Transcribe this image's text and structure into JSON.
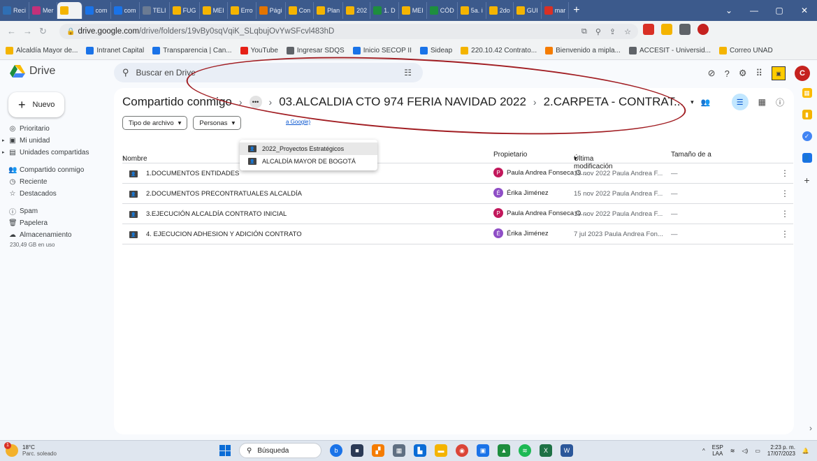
{
  "browser": {
    "tabs": [
      {
        "label": "Reci",
        "color": "#2f6fb4"
      },
      {
        "label": "Mer",
        "color": "#c3317a"
      },
      {
        "label": "",
        "color": "#f4b400",
        "active": true
      },
      {
        "label": "com",
        "color": "#1a73e8"
      },
      {
        "label": "com",
        "color": "#1a73e8"
      },
      {
        "label": "TELI",
        "color": "#6b7b93"
      },
      {
        "label": "FUG",
        "color": "#f4b400"
      },
      {
        "label": "MEI",
        "color": "#f4b400"
      },
      {
        "label": "Erro",
        "color": "#f4b400"
      },
      {
        "label": "Pági",
        "color": "#e37400"
      },
      {
        "label": "Con",
        "color": "#f4b400"
      },
      {
        "label": "Plan",
        "color": "#f4b400"
      },
      {
        "label": "202",
        "color": "#f4b400"
      },
      {
        "label": "1. D",
        "color": "#1e8e3e"
      },
      {
        "label": "MEI",
        "color": "#f4b400"
      },
      {
        "label": "CÓD",
        "color": "#1e8e3e"
      },
      {
        "label": "5a. i",
        "color": "#f4b400"
      },
      {
        "label": "2do",
        "color": "#f4b400"
      },
      {
        "label": "GUI",
        "color": "#f4b400"
      },
      {
        "label": "mar",
        "color": "#d93025"
      }
    ],
    "new_tab": "+",
    "url_host": "drive.google.com",
    "url_path": "/drive/folders/19vBy0sqVqiK_SLqbujOvYwSFcvl483hD",
    "bookmarks": [
      {
        "label": "Alcaldía Mayor de...",
        "color": "#f4b400"
      },
      {
        "label": "Intranet Capital",
        "color": "#1a73e8"
      },
      {
        "label": "Transparencia | Can...",
        "color": "#1a73e8"
      },
      {
        "label": "YouTube",
        "color": "#e62117"
      },
      {
        "label": "Ingresar SDQS",
        "color": "#5f6368"
      },
      {
        "label": "Inicio SECOP II",
        "color": "#1a73e8"
      },
      {
        "label": "Sideap",
        "color": "#1a73e8"
      },
      {
        "label": "220.10.42 Contrato...",
        "color": "#f4b400"
      },
      {
        "label": "Bienvenido a mipla...",
        "color": "#f57c00"
      },
      {
        "label": "ACCESIT - Universid...",
        "color": "#5f6368"
      },
      {
        "label": "Correo UNAD",
        "color": "#f4b400"
      }
    ]
  },
  "drive": {
    "app_name": "Drive",
    "search_placeholder": "Buscar en Drive",
    "new_button": "Nuevo",
    "nav": [
      {
        "label": "Prioritario",
        "icon": "check-circle-icon"
      },
      {
        "label": "Mi unidad",
        "icon": "my-drive-icon"
      },
      {
        "label": "Unidades compartidas",
        "icon": "shared-drives-icon"
      },
      {
        "label": "Compartido conmigo",
        "icon": "people-icon"
      },
      {
        "label": "Reciente",
        "icon": "clock-icon"
      },
      {
        "label": "Destacados",
        "icon": "star-icon"
      },
      {
        "label": "Spam",
        "icon": "spam-icon"
      },
      {
        "label": "Papelera",
        "icon": "trash-icon"
      },
      {
        "label": "Almacenamiento",
        "icon": "cloud-icon"
      }
    ],
    "storage_used": "230,49 GB en uso",
    "breadcrumb": {
      "root": "Compartido conmigo",
      "middle": "03.ALCALDIA CTO 974 FERIA NAVIDAD 2022",
      "current": "2.CARPETA - CONTRAT..."
    },
    "filters": {
      "type": "Tipo de archivo",
      "people": "Personas",
      "link": "a Google)"
    },
    "breadcrumb_menu": [
      "2022_Proyectos Estratégicos",
      "ALCALDÍA MAYOR DE BOGOTÁ"
    ],
    "columns": {
      "name": "Nombre",
      "owner": "Propietario",
      "modified": "Última modificación",
      "size": "Tamaño de a"
    },
    "rows": [
      {
        "name": "1.DOCUMENTOS ENTIDADES",
        "owner": "Paula Andrea Fonseca O...",
        "owner_initial": "P",
        "owner_color": "#c2185b",
        "modified": "15 nov 2022 Paula Andrea F...",
        "size": "—"
      },
      {
        "name": "2.DOCUMENTOS PRECONTRATUALES ALCALDÍA",
        "owner": "Érika Jiménez",
        "owner_initial": "É",
        "owner_color": "#8e4ec6",
        "modified": "15 nov 2022 Paula Andrea F...",
        "size": "—"
      },
      {
        "name": "3.EJECUCIÓN ALCALDÍA CONTRATO INICIAL",
        "owner": "Paula Andrea Fonseca O...",
        "owner_initial": "P",
        "owner_color": "#c2185b",
        "modified": "19 nov 2022 Paula Andrea F...",
        "size": "—"
      },
      {
        "name": "4. EJECUCION ADHESION Y ADICIÓN CONTRATO",
        "owner": "Érika Jiménez",
        "owner_initial": "É",
        "owner_color": "#8e4ec6",
        "modified": "7 jul 2023 Paula Andrea Fon...",
        "size": "—"
      }
    ]
  },
  "taskbar": {
    "temperature": "18°C",
    "weather": "Parc. soleado",
    "weather_badge": "1",
    "search": "Búsqueda",
    "lang_top": "ESP",
    "lang_bottom": "LAA",
    "time": "2:23 p. m.",
    "date": "17/07/2023"
  },
  "colors": {
    "annotation": "#a11d22",
    "accent": "#0b57d0",
    "filter_active": "#c2e7ff"
  }
}
